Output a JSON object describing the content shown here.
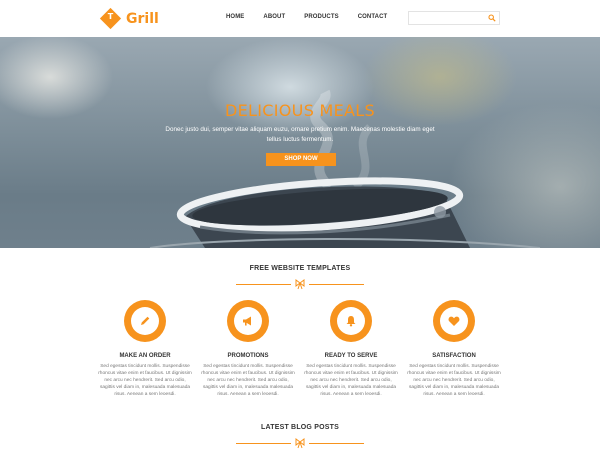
{
  "brand": {
    "logo_letter": "T",
    "name": "Grill",
    "accent": "#f7931d"
  },
  "nav": {
    "items": [
      "HOME",
      "ABOUT",
      "PRODUCTS",
      "CONTACT"
    ]
  },
  "search": {
    "placeholder": "",
    "icon": "search-icon"
  },
  "hero": {
    "title": "DELICIOUS MEALS",
    "text": "Donec justo dui, semper vitae aliquam euzu, ornare pretium enim. Maecenas molestie diam eget tellus luctus fermentum.",
    "button": "SHOP NOW"
  },
  "sections": {
    "templates_title": "FREE WEBSITE TEMPLATES",
    "blog_title": "LATEST BLOG POSTS"
  },
  "features": [
    {
      "title": "MAKE AN ORDER",
      "icon": "pencil-icon",
      "text": "Sed egestas tincidunt mollis. Suspendisse rhoncus vitae enim et faucibus. Ut dignissim nec arcu nec hendrerit. Sed arcu odio, sagittis vel diam in, malesuada malesuada risus. Aenean a sem leoesdi."
    },
    {
      "title": "PROMOTIONS",
      "icon": "megaphone-icon",
      "text": "Sed egestas tincidunt mollis. Suspendisse rhoncus vitae enim et faucibus. Ut dignissim nec arcu nec hendrerit. Sed arcu odio, sagittis vel diam in, malesuada malesuada risus. Aenean a sem leoesdi."
    },
    {
      "title": "READY TO SERVE",
      "icon": "bell-icon",
      "text": "Sed egestas tincidunt mollis. Suspendisse rhoncus vitae enim et faucibus. Ut dignissim nec arcu nec hendrerit. Sed arcu odio, sagittis vel diam in, malesuada malesuada risus. Aenean a sem leoesdi."
    },
    {
      "title": "SATISFACTION",
      "icon": "heart-icon",
      "text": "Sed egestas tincidunt mollis. Suspendisse rhoncus vitae enim et faucibus. Ut dignissim nec arcu nec hendrerit. Sed arcu odio, sagittis vel diam in, malesuada malesuada risus. Aenean a sem leoesdi."
    }
  ]
}
